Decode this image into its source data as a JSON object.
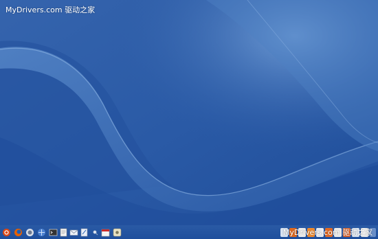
{
  "watermark": {
    "top_text": "MyDrivers.com 驱动之家",
    "bottom_text": "MyDrivers.com 驱动之家"
  },
  "colors": {
    "wallpaper_base": "#2a5aa6",
    "wallpaper_highlight": "#6d9ad3",
    "taskbar": "#2456a0",
    "watermark_text": "#ffffff"
  },
  "taskbar": {
    "launcher_icons": [
      "ubuntu-logo-icon",
      "firefox-icon",
      "pidgin-icon",
      "network-icon",
      "terminal-icon",
      "text-editor-icon",
      "mail-icon",
      "document-icon",
      "search-icon",
      "calendar-icon",
      "settings-icon"
    ],
    "tray_icons": [
      "tray-app-icon",
      "tray-app-icon",
      "tray-app-icon",
      "tray-app-icon",
      "tray-app-icon",
      "tray-app-icon",
      "tray-app-icon",
      "tray-app-icon",
      "tray-app-icon",
      "tray-app-icon",
      "tray-app-icon"
    ]
  }
}
